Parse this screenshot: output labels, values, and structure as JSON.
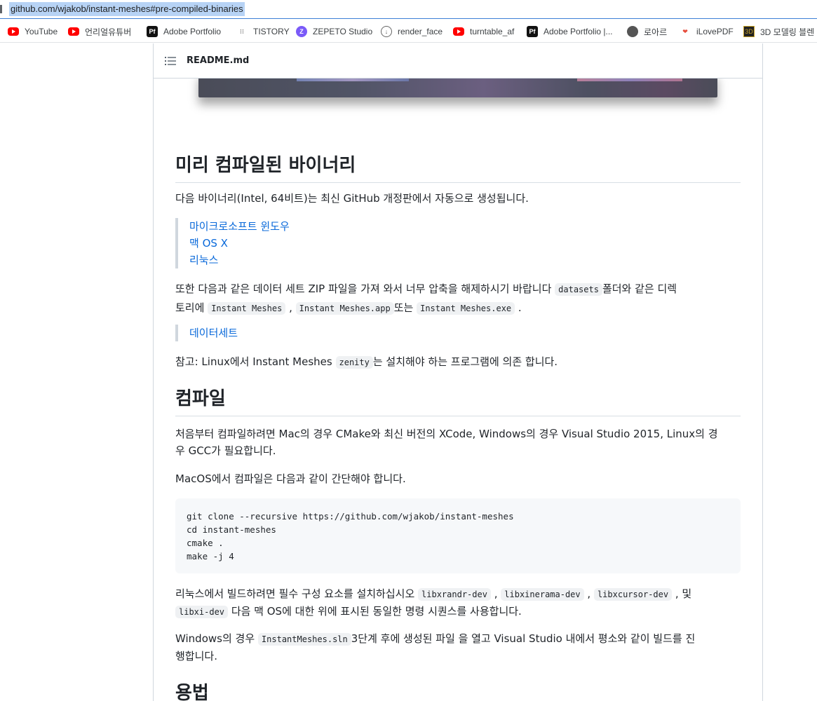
{
  "browser": {
    "url": "github.com/wjakob/instant-meshes#pre-compiled-binaries",
    "bookmarks": [
      {
        "label": "YouTube",
        "icon": "youtube-icon"
      },
      {
        "label": "언리얼유튜버",
        "icon": "youtube-icon"
      },
      {
        "label": "Adobe Portfolio",
        "icon": "adobe-portfolio-icon"
      },
      {
        "label": "TISTORY",
        "icon": "tistory-icon"
      },
      {
        "label": "ZEPETO Studio",
        "icon": "zepeto-icon"
      },
      {
        "label": "render_face",
        "icon": "render-face-icon"
      },
      {
        "label": "turntable_af",
        "icon": "youtube-icon"
      },
      {
        "label": "Adobe Portfolio |...",
        "icon": "adobe-portfolio-icon"
      },
      {
        "label": "로아르",
        "icon": "globe-icon"
      },
      {
        "label": "iLovePDF",
        "icon": "ilovepdf-icon"
      },
      {
        "label": "3D 모델링 블렌",
        "icon": "3d-modeling-icon"
      }
    ]
  },
  "readme": {
    "header_title": "README.md",
    "sections": {
      "binaries_heading": "미리 컴파일된 바이너리",
      "binaries_intro": "다음 바이너리(Intel, 64비트)는 최신 GitHub 개정판에서 자동으로 생성됩니다.",
      "binary_links": [
        "마이크로소프트 윈도우",
        "맥 OS X",
        "리눅스"
      ],
      "datasets_text_1": "또한 다음과 같은 데이터 세트 ZIP 파일을 가져 와서 너무 압축을 해제하시기 바랍니다",
      "datasets_code_1": "datasets",
      "datasets_text_2": "폴더와 같은 디렉",
      "datasets_text_3": "토리에",
      "datasets_code_2": "Instant Meshes",
      "datasets_code_3": "Instant Meshes.app",
      "datasets_text_4": "또는",
      "datasets_code_4": "Instant Meshes.exe",
      "datasets_link": "데이터세트",
      "note_text_1": "참고: Linux에서 Instant Meshes",
      "note_code": "zenity",
      "note_text_2": "는 설치해야 하는 프로그램에 의존 합니다.",
      "compile_heading": "컴파일",
      "compile_intro_1": "처음부터 컴파일하려면 Mac의 경우 CMake와 최신 버전의 XCode, Windows의 경우 Visual Studio 2015, Linux의 경",
      "compile_intro_2": "우 GCC가 필요합니다.",
      "macos_text": "MacOS에서 컴파일은 다음과 같이 간단해야 합니다.",
      "code_lines": [
        "git clone --recursive https://github.com/wjakob/instant-meshes",
        "cd instant-meshes",
        "cmake .",
        "make -j 4"
      ],
      "linux_text_1": "리눅스에서 빌드하려면 필수 구성 요소를 설치하십시오",
      "linux_code_1": "libxrandr-dev",
      "linux_code_2": "libxinerama-dev",
      "linux_code_3": "libxcursor-dev",
      "linux_text_2": "및",
      "linux_code_4": "libxi-dev",
      "linux_text_3": "다음 맥 OS에 대한 위에 표시된 동일한 명령 시퀀스를 사용합니다.",
      "windows_text_1": "Windows의 경우",
      "windows_code": "InstantMeshes.sln",
      "windows_text_2": "3단계 후에 생성된 파일 을 열고 Visual Studio 내에서 평소와 같이 빌드를 진",
      "windows_text_3": "행합니다.",
      "usage_heading": "용법"
    }
  },
  "colors": {
    "link": "#0969da",
    "url_highlight": "#b7d3f5",
    "youtube": "#ff0000"
  }
}
